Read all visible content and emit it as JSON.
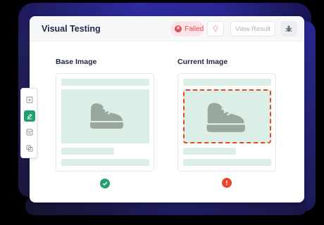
{
  "header": {
    "title": "Visual Testing",
    "status_label": "Failed",
    "view_result_label": "View Result"
  },
  "icons": {
    "status": "x-circle-icon",
    "hint": "lightbulb-icon",
    "debug": "bug-icon",
    "shoe": "shoe-icon",
    "pass": "check-circle-icon",
    "fail": "exclamation-circle-icon"
  },
  "columns": {
    "base": {
      "label": "Base Image",
      "result": "pass"
    },
    "current": {
      "label": "Current Image",
      "result": "fail"
    }
  },
  "toolbar": {
    "tools": [
      "add-frame-icon",
      "highlight-icon",
      "layout-icon",
      "compare-icon"
    ],
    "active_index": 1
  },
  "colors": {
    "fail": "#e34b5a",
    "pass": "#23a06e",
    "diff_outline": "#e34a2a",
    "placeholder": "#dcefe6",
    "shoe": "#9aa79f",
    "accent_tool": "#1f9e6e"
  }
}
